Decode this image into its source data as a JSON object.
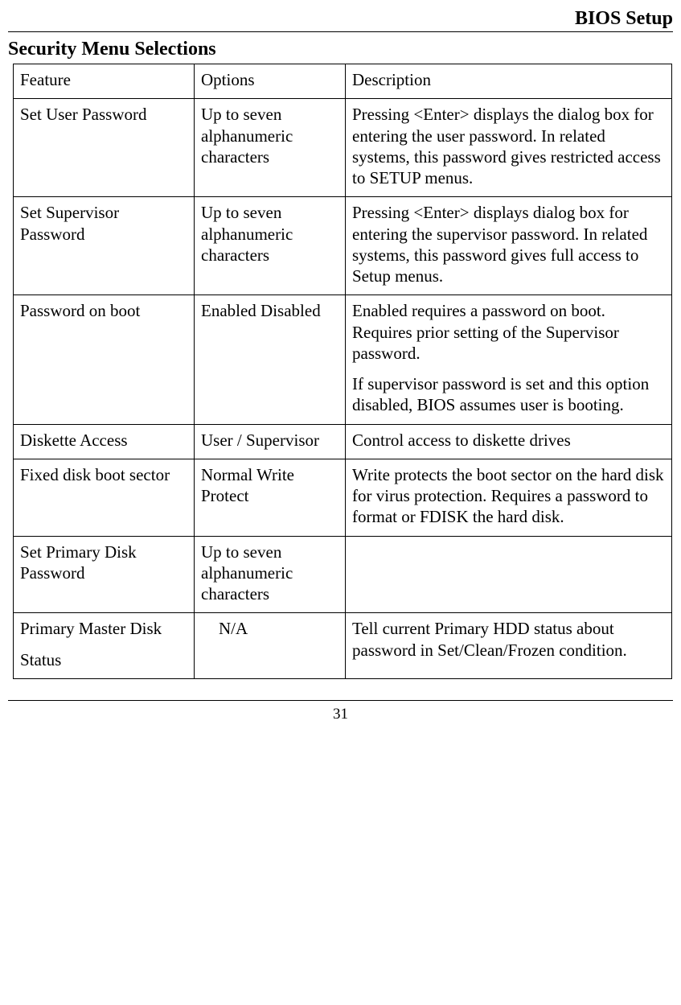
{
  "header": {
    "title": "BIOS Setup"
  },
  "section_heading": "Security Menu Selections",
  "table": {
    "headers": {
      "feature": "Feature",
      "options": "Options",
      "description": "Description"
    },
    "rows": [
      {
        "feature": "Set User Password",
        "options": "Up to seven alphanumeric characters",
        "description": [
          "Pressing <Enter> displays the dialog box for entering the user password. In related systems, this password gives restricted access to SETUP menus."
        ]
      },
      {
        "feature": "Set Supervisor Password",
        "options": "Up to seven alphanumeric characters",
        "description": [
          "Pressing <Enter> displays dialog box for entering the supervisor password. In related systems, this password gives full access to Setup menus."
        ]
      },
      {
        "feature": "Password on boot",
        "options": "Enabled Disabled",
        "description": [
          "Enabled requires a password on boot. Requires prior setting of the Supervisor password.",
          "If supervisor password is set and this option disabled, BIOS assumes user is booting."
        ]
      },
      {
        "feature": "Diskette Access",
        "options": "User / Supervisor",
        "description": [
          "Control access to diskette drives"
        ]
      },
      {
        "feature": "Fixed disk boot sector",
        "options": "Normal Write Protect",
        "description": [
          "Write protects the boot sector on the hard disk for virus protection. Requires a password to format or FDISK the hard disk."
        ]
      },
      {
        "feature": "Set Primary Disk Password",
        "options": "Up to seven alphanumeric characters",
        "description": [
          ""
        ]
      },
      {
        "feature_l1": "Primary Master Disk",
        "feature_l2": "Status",
        "options": "N/A",
        "description": [
          "Tell current Primary HDD status about password in Set/Clean/Frozen condition."
        ]
      }
    ]
  },
  "page_number": "31"
}
